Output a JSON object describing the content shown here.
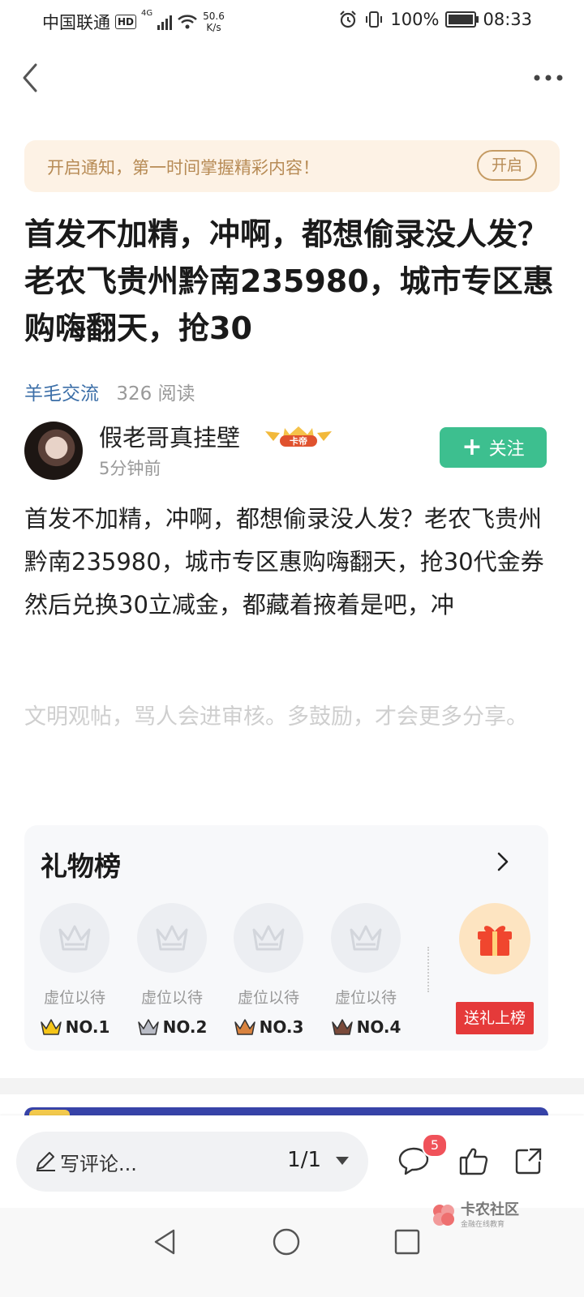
{
  "status_bar": {
    "carrier": "中国联通",
    "hd": "HD",
    "net": "4G",
    "speed_value": "50.6",
    "speed_unit": "K/s",
    "battery": "100%",
    "time": "08:33"
  },
  "notice": {
    "text": "开启通知，第一时间掌握精彩内容！",
    "button": "开启"
  },
  "post": {
    "title": "首发不加精，冲啊，都想偷录没人发？老农飞贵州黔南235980，城市专区惠购嗨翻天，抢30",
    "category": "羊毛交流",
    "reads": "326 阅读",
    "body": "首发不加精，冲啊，都想偷录没人发？老农飞贵州黔南235980，城市专区惠购嗨翻天，抢30代金券然后兑换30立减金，都藏着掖着是吧，冲",
    "civil_note": "文明观帖，骂人会进审核。多鼓励，才会更多分享。"
  },
  "author": {
    "name": "假老哥真挂壁",
    "badge": "卡帝",
    "time": "5分钟前",
    "follow_label": "关注",
    "follow_plus": "+"
  },
  "gift_board": {
    "title": "礼物榜",
    "slots": [
      {
        "placeholder": "虚位以待",
        "rank": "NO.1",
        "crown_color": "#f5c518"
      },
      {
        "placeholder": "虚位以待",
        "rank": "NO.2",
        "crown_color": "#b9bcc6"
      },
      {
        "placeholder": "虚位以待",
        "rank": "NO.3",
        "crown_color": "#d9833f"
      },
      {
        "placeholder": "虚位以待",
        "rank": "NO.4",
        "crown_color": "#7a4a3a"
      }
    ],
    "send_label": "送礼上榜"
  },
  "bottom_bar": {
    "comment_placeholder": "写评论...",
    "page_indicator": "1/1",
    "comment_count": "5"
  },
  "watermark": {
    "title": "卡农社区",
    "subtitle": "金融在线教育"
  },
  "colors": {
    "accent_green": "#3dbf8f",
    "link_blue": "#3c6fa8",
    "notice_bg": "#fdf2e5",
    "notice_text": "#b78b55",
    "gift_red": "#e53a3a",
    "badge_red": "#f0525a"
  }
}
